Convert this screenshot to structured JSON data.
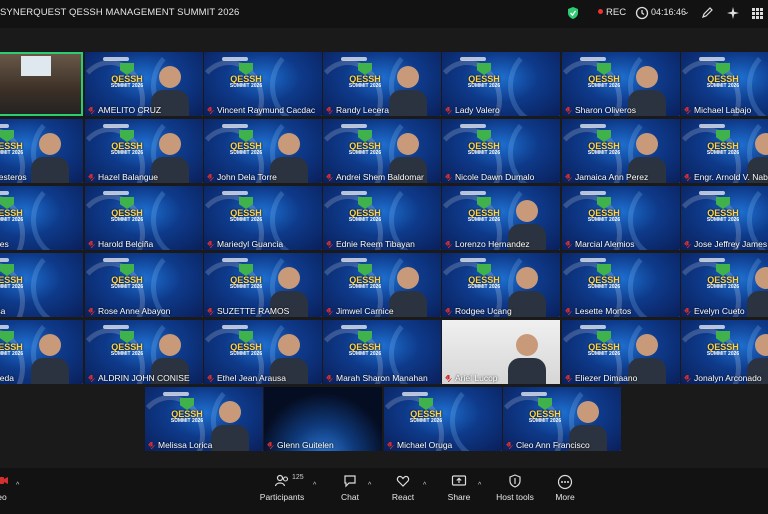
{
  "window": {
    "title": "SYNERQUEST QESSH MANAGEMENT SUMMIT 2026"
  },
  "topbar": {
    "rec_label": "REC",
    "timer": "04:16:46"
  },
  "branding": {
    "logo_text": "QESSH",
    "logo_sub": "SUMMIT 2026"
  },
  "participants": [
    [
      {
        "name": "ESSH",
        "type": "room",
        "active": true
      },
      {
        "name": "AMELITO CRUZ",
        "video": true
      },
      {
        "name": "Vincent Raymund Cacdac"
      },
      {
        "name": "Randy Lecera",
        "video": true
      },
      {
        "name": "Lady Valero"
      },
      {
        "name": "Sharon Oliveros",
        "video": true
      },
      {
        "name": "Michael Labajo"
      }
    ],
    [
      {
        "name": "y Ballesteros",
        "video": true
      },
      {
        "name": "Hazel Balangue",
        "video": true
      },
      {
        "name": "John Dela Torre",
        "video": true
      },
      {
        "name": "Andrei Shem Baldomar",
        "video": true
      },
      {
        "name": "Nicole Dawn Dumalo"
      },
      {
        "name": "Jamaica Ann Perez",
        "video": true
      },
      {
        "name": "Engr. Arnold V. Nabu",
        "video": true
      }
    ],
    [
      {
        "name": "er Zules"
      },
      {
        "name": "Harold Belciña"
      },
      {
        "name": "Mariedyl Guancia"
      },
      {
        "name": "Ednie Reem Tibayan"
      },
      {
        "name": "Lorenzo Hernandez",
        "video": true
      },
      {
        "name": "Marcial Alemios"
      },
      {
        "name": "Jose Jeffrey James O"
      }
    ],
    [
      {
        "name": "Tenosa"
      },
      {
        "name": "Rose Anne Abayon"
      },
      {
        "name": "SUZETTE RAMOS",
        "video": true
      },
      {
        "name": "Jimwel Carnice",
        "video": true
      },
      {
        "name": "Rodgee Ucang",
        "video": true
      },
      {
        "name": "Lesette Mortos"
      },
      {
        "name": "Evelyn Cueto",
        "video": true
      }
    ],
    [
      {
        "name": "L. Pineda",
        "video": true
      },
      {
        "name": "ALDRIN JOHN CONISE",
        "video": true
      },
      {
        "name": "Ethel Jean Arausa",
        "video": true
      },
      {
        "name": "Marah Sharon Manahan"
      },
      {
        "name": "Ariel Lucop",
        "type": "light",
        "video": true
      },
      {
        "name": "Eliezer Dimaano",
        "video": true
      },
      {
        "name": "Jonalyn Arconado",
        "video": true
      }
    ],
    [
      {
        "name": "Melissa Lorica",
        "video": true
      },
      {
        "name": "Glenn Guitelen",
        "type": "space"
      },
      {
        "name": "Michael Oruga"
      },
      {
        "name": "Cleo Ann Francisco",
        "video": true
      }
    ]
  ],
  "toolbar": {
    "participants_count": "125",
    "items": [
      {
        "label": "eo",
        "icon": "video-icon"
      },
      {
        "label": "Participants",
        "icon": "participants-icon"
      },
      {
        "label": "Chat",
        "icon": "chat-icon"
      },
      {
        "label": "React",
        "icon": "heart-icon"
      },
      {
        "label": "Share",
        "icon": "share-icon"
      },
      {
        "label": "Host tools",
        "icon": "shield-icon"
      },
      {
        "label": "More",
        "icon": "more-icon"
      }
    ]
  },
  "colors": {
    "accent": "#2ecc71",
    "rec": "#e33333",
    "tile_bg": "#0e3a8a",
    "muted_mic": "#d32f2f",
    "logo_yellow": "#ffd24a"
  }
}
